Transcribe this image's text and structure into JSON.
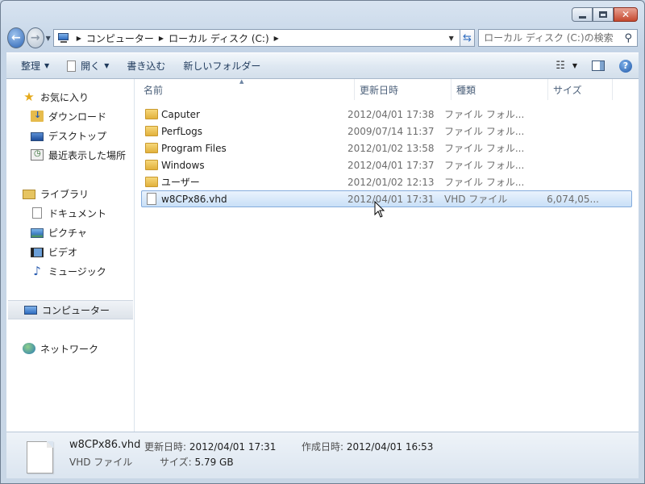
{
  "window": {
    "caption": {
      "minimize": "▁",
      "maximize": "□",
      "close": "✕"
    }
  },
  "navigation": {
    "breadcrumbs": [
      "コンピューター",
      "ローカル ディスク (C:)"
    ],
    "search_placeholder": "ローカル ディスク (C:)の検索"
  },
  "toolbar": {
    "organize": "整理",
    "open": "開く",
    "burn": "書き込む",
    "new_folder": "新しいフォルダー"
  },
  "sidebar": {
    "favorites": "お気に入り",
    "favorite_items": [
      "ダウンロード",
      "デスクトップ",
      "最近表示した場所"
    ],
    "libraries": "ライブラリ",
    "library_items": [
      "ドキュメント",
      "ピクチャ",
      "ビデオ",
      "ミュージック"
    ],
    "computer": "コンピューター",
    "network": "ネットワーク"
  },
  "columns": {
    "name": "名前",
    "date": "更新日時",
    "type": "種類",
    "size": "サイズ"
  },
  "files": [
    {
      "name": "Caputer",
      "date": "2012/04/01 17:38",
      "type": "ファイル フォル...",
      "size": ""
    },
    {
      "name": "PerfLogs",
      "date": "2009/07/14 11:37",
      "type": "ファイル フォル...",
      "size": ""
    },
    {
      "name": "Program Files",
      "date": "2012/01/02 13:58",
      "type": "ファイル フォル...",
      "size": ""
    },
    {
      "name": "Windows",
      "date": "2012/04/01 17:37",
      "type": "ファイル フォル...",
      "size": ""
    },
    {
      "name": "ユーザー",
      "date": "2012/01/02 12:13",
      "type": "ファイル フォル...",
      "size": ""
    },
    {
      "name": "w8CPx86.vhd",
      "date": "2012/04/01 17:31",
      "type": "VHD ファイル",
      "size": "6,074,05..."
    }
  ],
  "details": {
    "name": "w8CPx86.vhd",
    "type": "VHD ファイル",
    "modified_label": "更新日時:",
    "modified": "2012/04/01 17:31",
    "created_label": "作成日時:",
    "created": "2012/04/01 16:53",
    "size_label": "サイズ:",
    "size": "5.79 GB"
  }
}
